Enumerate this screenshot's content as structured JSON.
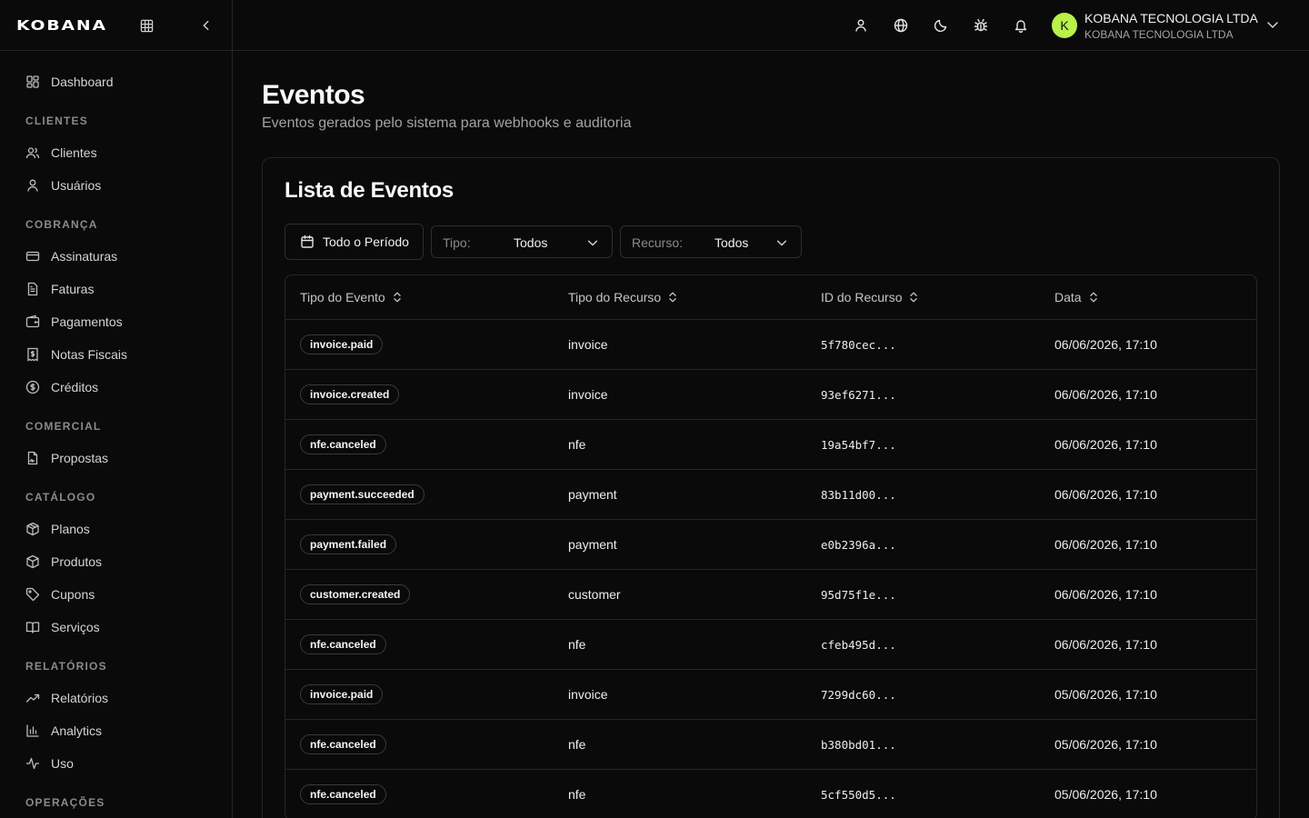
{
  "brand": {
    "logo_text": "KOBANA"
  },
  "sidebar": {
    "items": {
      "dashboard": "Dashboard",
      "clientes": "Clientes",
      "usuarios": "Usuários",
      "assinaturas": "Assinaturas",
      "faturas": "Faturas",
      "pagamentos": "Pagamentos",
      "notas_fiscais": "Notas Fiscais",
      "creditos": "Créditos",
      "propostas": "Propostas",
      "planos": "Planos",
      "produtos": "Produtos",
      "cupons": "Cupons",
      "servicos": "Serviços",
      "relatorios": "Relatórios",
      "analytics": "Analytics",
      "uso": "Uso"
    },
    "sections": {
      "clientes": "CLIENTES",
      "cobranca": "COBRANÇA",
      "comercial": "COMERCIAL",
      "catalogo": "CATÁLOGO",
      "relatorios": "RELATÓRIOS",
      "operacoes": "OPERAÇÕES"
    }
  },
  "header": {
    "org_name": "KOBANA TECNOLOGIA LTDA",
    "org_subtitle": "KOBANA TECNOLOGIA LTDA",
    "avatar_initial": "K",
    "avatar_color": "#b7f14a"
  },
  "page": {
    "title": "Eventos",
    "subtitle": "Eventos gerados pelo sistema para webhooks e auditoria"
  },
  "card": {
    "title": "Lista de Eventos",
    "filters": {
      "period": "Todo o Período",
      "type_label": "Tipo:",
      "type_value": "Todos",
      "resource_label": "Recurso:",
      "resource_value": "Todos"
    },
    "columns": {
      "event_type": "Tipo do Evento",
      "resource_type": "Tipo do Recurso",
      "resource_id": "ID do Recurso",
      "date": "Data"
    },
    "rows": [
      {
        "event": "invoice.paid",
        "resource": "invoice",
        "id": "5f780cec...",
        "date": "06/06/2026, 17:10"
      },
      {
        "event": "invoice.created",
        "resource": "invoice",
        "id": "93ef6271...",
        "date": "06/06/2026, 17:10"
      },
      {
        "event": "nfe.canceled",
        "resource": "nfe",
        "id": "19a54bf7...",
        "date": "06/06/2026, 17:10"
      },
      {
        "event": "payment.succeeded",
        "resource": "payment",
        "id": "83b11d00...",
        "date": "06/06/2026, 17:10"
      },
      {
        "event": "payment.failed",
        "resource": "payment",
        "id": "e0b2396a...",
        "date": "06/06/2026, 17:10"
      },
      {
        "event": "customer.created",
        "resource": "customer",
        "id": "95d75f1e...",
        "date": "06/06/2026, 17:10"
      },
      {
        "event": "nfe.canceled",
        "resource": "nfe",
        "id": "cfeb495d...",
        "date": "06/06/2026, 17:10"
      },
      {
        "event": "invoice.paid",
        "resource": "invoice",
        "id": "7299dc60...",
        "date": "05/06/2026, 17:10"
      },
      {
        "event": "nfe.canceled",
        "resource": "nfe",
        "id": "b380bd01...",
        "date": "05/06/2026, 17:10"
      },
      {
        "event": "nfe.canceled",
        "resource": "nfe",
        "id": "5cf550d5...",
        "date": "05/06/2026, 17:10"
      }
    ]
  }
}
